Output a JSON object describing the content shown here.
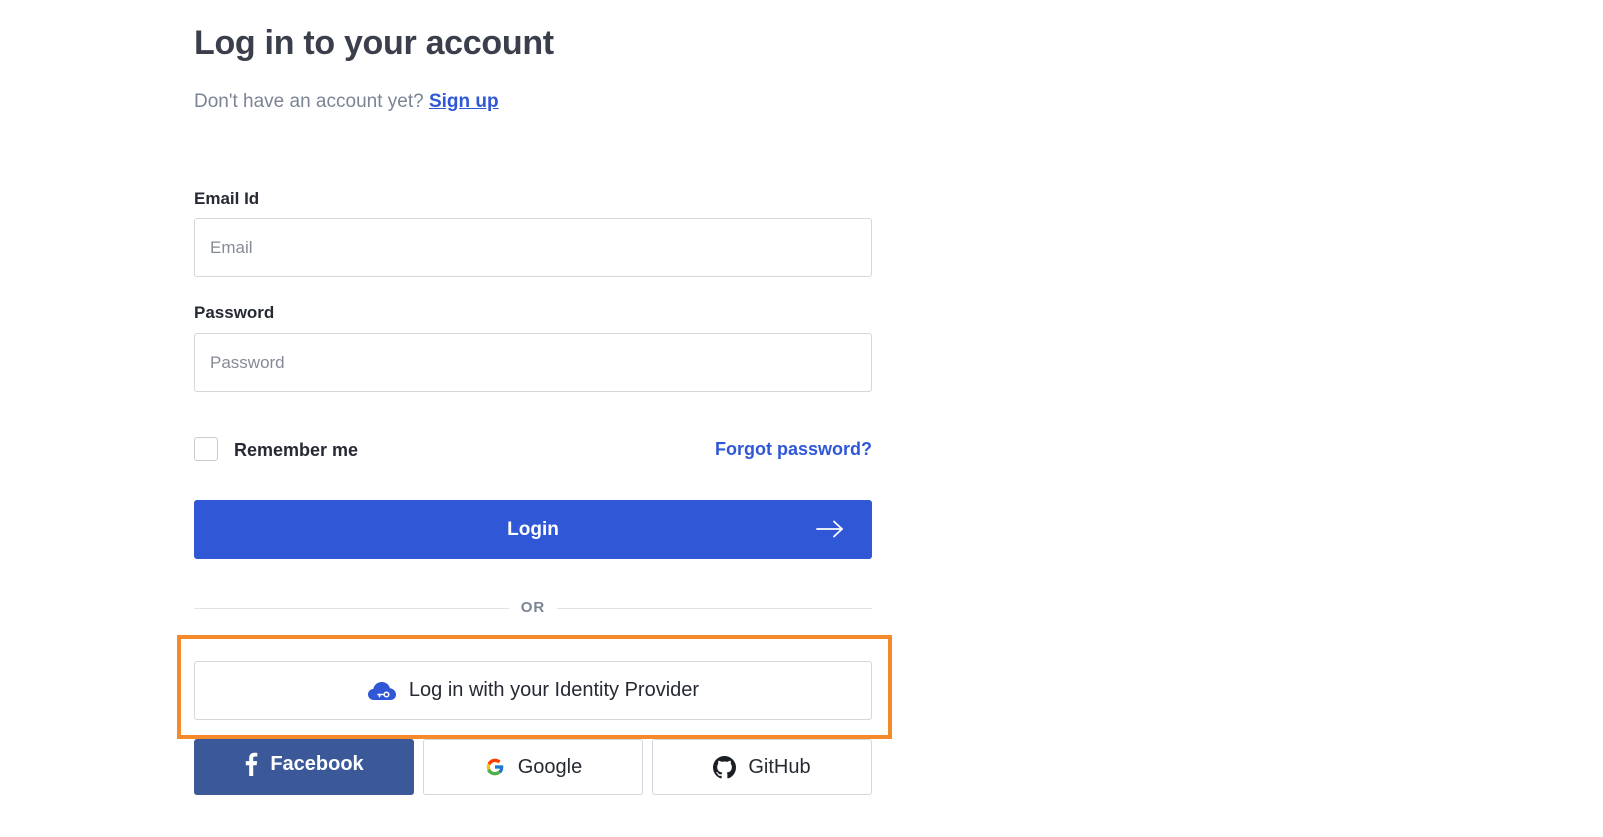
{
  "header": {
    "title": "Log in to your account",
    "signup_prompt": "Don't have an account yet?",
    "signup_link": "Sign up"
  },
  "form": {
    "email_label": "Email Id",
    "email_placeholder": "Email",
    "email_value": "",
    "password_label": "Password",
    "password_placeholder": "Password",
    "password_value": "",
    "remember_label": "Remember me",
    "remember_checked": false,
    "forgot_label": "Forgot password?",
    "login_label": "Login"
  },
  "divider": {
    "text": "OR"
  },
  "sso": {
    "idp_label": "Log in with your Identity Provider",
    "idp_icon": "cloud-key-icon"
  },
  "social": {
    "facebook_label": "Facebook",
    "google_label": "Google",
    "github_label": "GitHub"
  },
  "colors": {
    "primary": "#2f57d6",
    "facebook": "#3b5998",
    "highlight": "#f58a2a",
    "heading": "#3a3f4b",
    "muted": "#7b8494"
  }
}
